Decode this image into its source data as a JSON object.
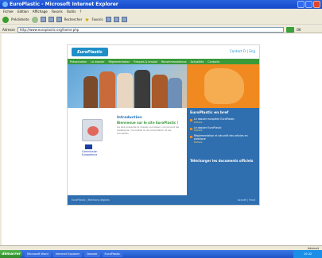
{
  "window": {
    "title": "EuroPlastic - Microsoft Internet Explorer"
  },
  "menu": [
    "Fichier",
    "Edition",
    "Affichage",
    "Favoris",
    "Outils",
    "?"
  ],
  "toolbar": {
    "back_label": "Précédente",
    "search_label": "Rechercher",
    "favorites_label": "Favoris"
  },
  "address": {
    "label": "Adresse",
    "url": "http://www.europlastic.org/home.php",
    "go_label": "OK"
  },
  "site": {
    "logo": "EuroPlastic",
    "header_link": "Contact Fr | Eng",
    "nav": [
      "Présentation",
      "Le dossier",
      "Réglementation",
      "Risques & emploi",
      "Recommandations",
      "Actualités",
      "Contacts"
    ],
    "intro_title": "Introduction",
    "intro_subtitle": "Bienvenue sur le site EuroPlastic !",
    "intro_text": "Ce site présente le dossier européen concernant les plastiques. Consultez la documentation et les actualités.",
    "flag_caption": "Commission Européenne",
    "news_title": "EuroPlastic en bref",
    "news": [
      {
        "text": "Le dossier européen EuroPlastic",
        "more": "Détails"
      },
      {
        "text": "Le dossier EuroPlastic",
        "more": "Détails"
      },
      {
        "text": "Réglementation et sécurité des articles en plastique",
        "more": "Détails"
      }
    ],
    "download": "Télécharger les documents officiels",
    "footer_left": "EuroPlastic | Mentions légales",
    "footer_right": "Accueil | Haut"
  },
  "status": {
    "text": "",
    "zone": "Internet"
  },
  "taskbar": {
    "start": "démarrer",
    "tasks": [
      "Microsoft Word",
      "Internet Explorer",
      "Dossier",
      "EuroPlastic"
    ],
    "clock": "10:32"
  },
  "colors": {
    "nav_green": "#3a9a3a",
    "brand_blue": "#2f6fb0",
    "accent_orange": "#f08a20"
  }
}
